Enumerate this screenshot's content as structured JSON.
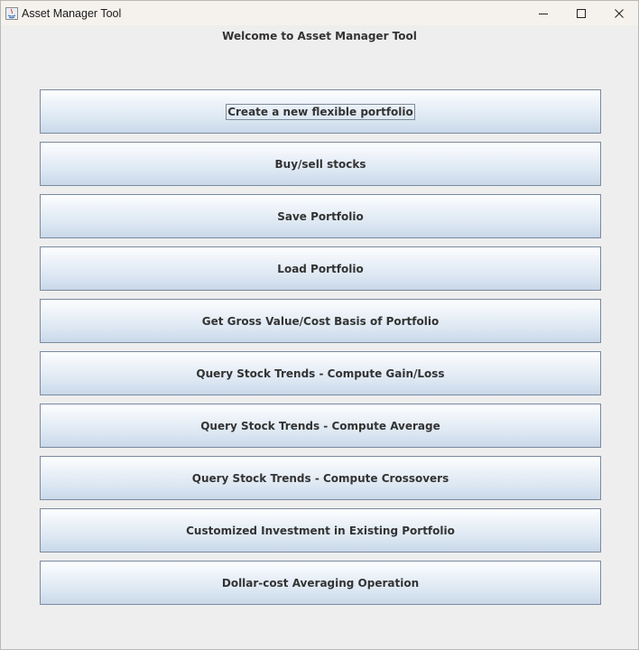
{
  "window": {
    "title": "Asset Manager Tool",
    "controls": [
      "minimize-icon",
      "maximize-icon",
      "close-icon"
    ]
  },
  "header": {
    "welcome": "Welcome to Asset Manager Tool"
  },
  "menu": {
    "buttons": [
      {
        "label": "Create a new flexible portfolio"
      },
      {
        "label": "Buy/sell stocks"
      },
      {
        "label": "Save Portfolio"
      },
      {
        "label": "Load Portfolio"
      },
      {
        "label": "Get Gross Value/Cost Basis of Portfolio"
      },
      {
        "label": "Query Stock Trends - Compute Gain/Loss"
      },
      {
        "label": "Query Stock Trends - Compute Average"
      },
      {
        "label": "Query Stock Trends - Compute Crossovers"
      },
      {
        "label": "Customized Investment in Existing Portfolio"
      },
      {
        "label": "Dollar-cost Averaging Operation"
      }
    ],
    "focused_index": 0
  },
  "colors": {
    "titlebar_bg": "#f5f2ed",
    "window_bg": "#eeeeee",
    "button_border": "#7a8aa0",
    "text": "#333333"
  }
}
